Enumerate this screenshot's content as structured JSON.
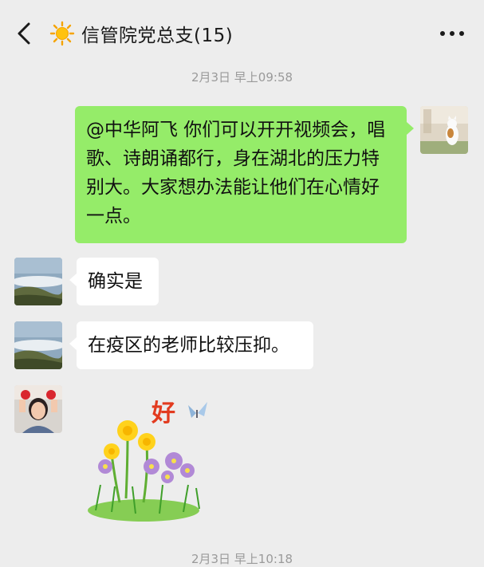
{
  "header": {
    "title": "信管院党总支(15)",
    "back_icon": "chevron-left-icon",
    "emoji_icon": "sun-icon",
    "more_icon": "more-dots-icon"
  },
  "timestamps": [
    "2月3日 早上09:58",
    "2月3日 早上10:18"
  ],
  "messages": [
    {
      "side": "right",
      "text": "@中华阿飞  你们可以开开视频会，唱歌、诗朗诵都行，身在湖北的压力特别大。大家想办法能让他们在心情好一点。"
    },
    {
      "side": "left",
      "text": "确实是"
    },
    {
      "side": "left",
      "text": "在疫区的老师比较压抑。"
    },
    {
      "side": "left",
      "type": "sticker",
      "sticker_text": "好"
    }
  ],
  "colors": {
    "background": "#ededed",
    "sent_bubble": "#95ec69",
    "received_bubble": "#ffffff",
    "timestamp": "#9a9a9a"
  }
}
